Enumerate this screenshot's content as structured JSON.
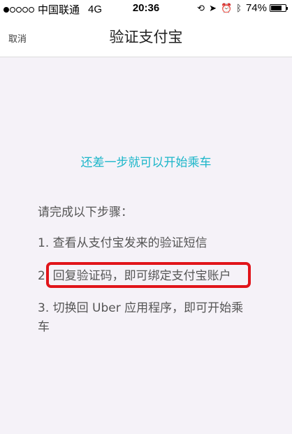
{
  "status_bar": {
    "carrier": "中国联通",
    "network": "4G",
    "time": "20:36",
    "battery_percent": "74%",
    "battery_level": 0.74,
    "signal_bars_filled": 1,
    "signal_bars_total": 5,
    "icons": [
      "orientation-lock-icon",
      "location-arrow-icon",
      "alarm-icon",
      "bluetooth-icon"
    ]
  },
  "nav": {
    "cancel_label": "取消",
    "title": "验证支付宝"
  },
  "content": {
    "headline": "还差一步就可以开始乘车",
    "intro": "请完成以下步骤：",
    "steps": [
      "1. 查看从支付宝发来的验证短信",
      "2. 回复验证码，即可绑定支付宝账户",
      "3. 切换回 Uber 应用程序，即可开始乘车"
    ],
    "highlight_color": "#e1141a",
    "headline_color": "#1bb6c9"
  }
}
